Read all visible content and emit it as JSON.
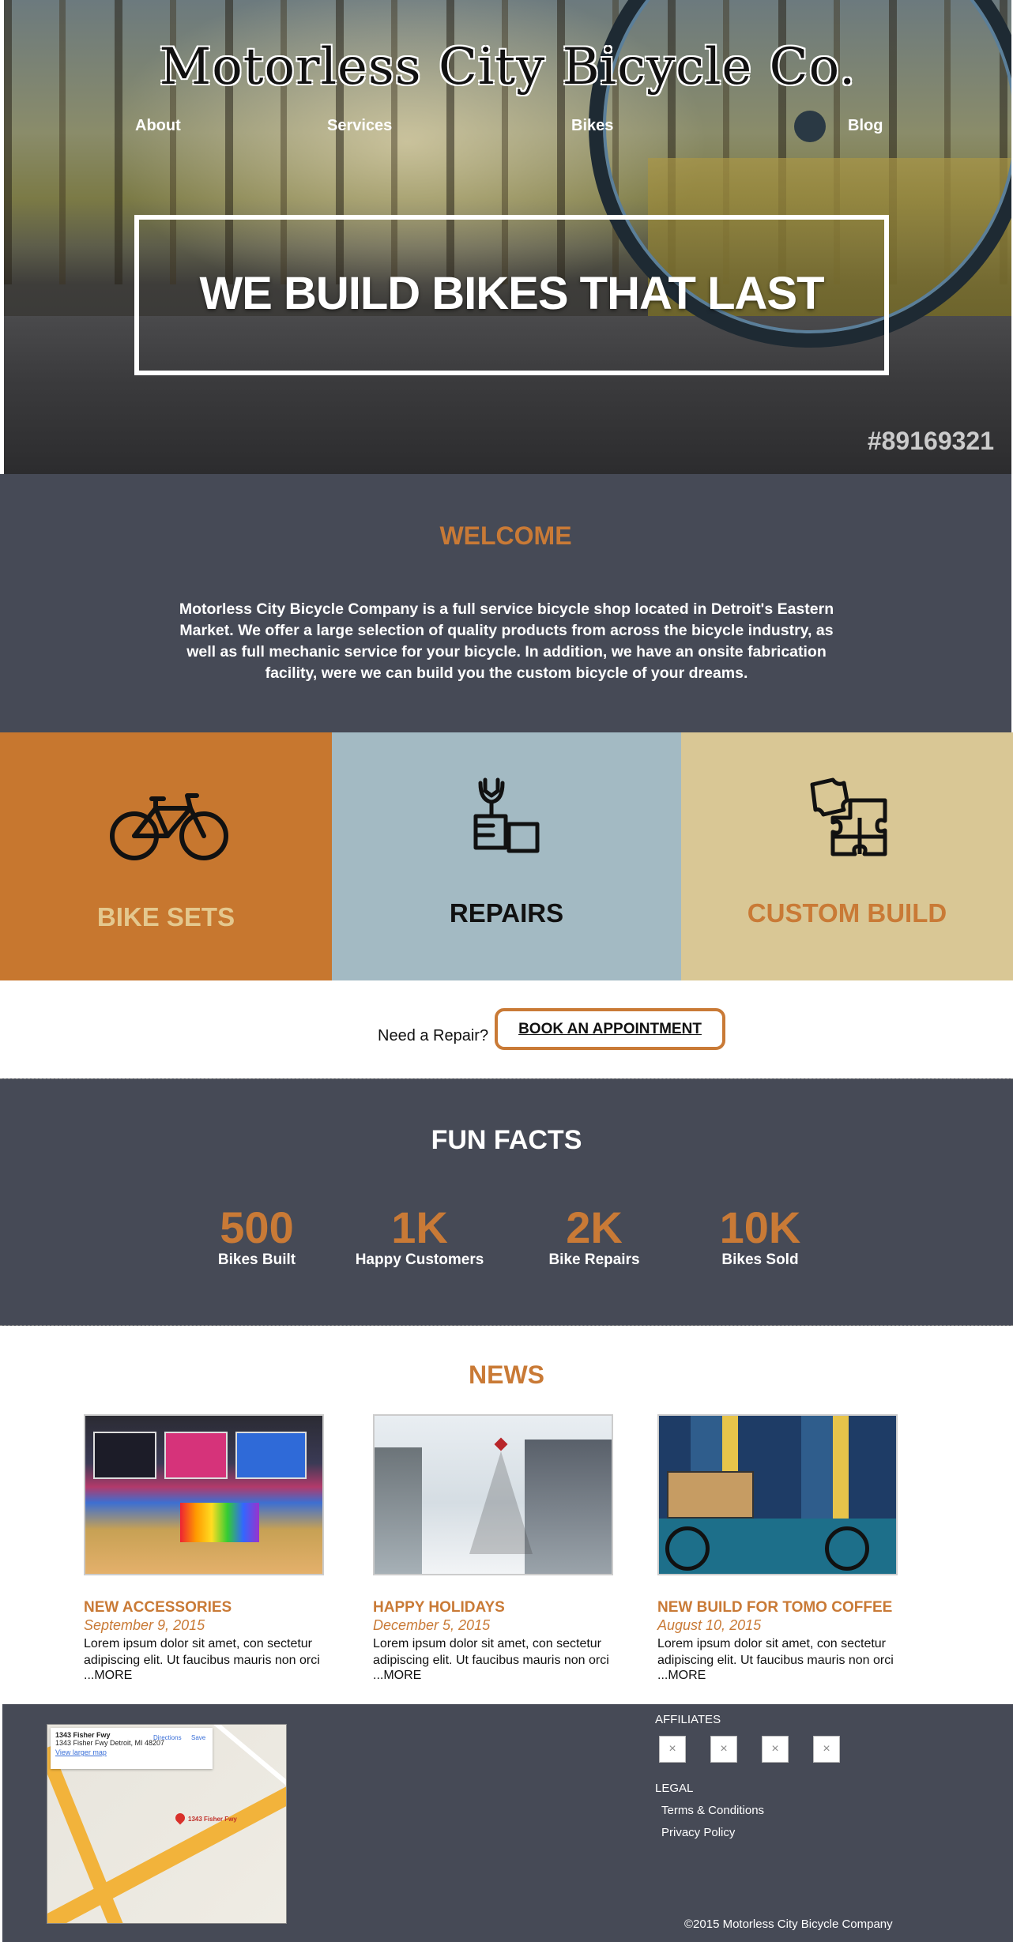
{
  "header": {
    "logo": "Motorless City Bicycle Co.",
    "nav": [
      "About",
      "Services",
      "Bikes",
      "Blog"
    ]
  },
  "hero": {
    "headline": "WE BUILD BIKES THAT LAST",
    "stock_id": "#89169321"
  },
  "welcome": {
    "title": "WELCOME",
    "body": "Motorless City Bicycle Company is a full service bicycle shop located in Detroit's Eastern Market.  We offer a large selection of quality products from across the bicycle industry, as well as full mechanic service for your bicycle.  In addition, we have an onsite fabrication facility, were we can build you the custom bicycle of your dreams."
  },
  "services": [
    {
      "label": "BIKE SETS",
      "icon": "bicycle-icon",
      "bg": "#c7772f",
      "fg": "#e4c88e"
    },
    {
      "label": "REPAIRS",
      "icon": "wrench-hand-icon",
      "bg": "#a3bac3",
      "fg": "#111111"
    },
    {
      "label": "CUSTOM BUILD",
      "icon": "puzzle-icon",
      "bg": "#d9c795",
      "fg": "#c97a36"
    }
  ],
  "cta": {
    "prompt": "Need a Repair?",
    "button": "BOOK AN APPOINTMENT"
  },
  "facts": {
    "title": "FUN FACTS",
    "items": [
      {
        "num": "500",
        "caption": "Bikes Built"
      },
      {
        "num": "1K",
        "caption": "Happy Customers"
      },
      {
        "num": "2K",
        "caption": "Bike Repairs"
      },
      {
        "num": "10K",
        "caption": "Bikes Sold"
      }
    ]
  },
  "news": {
    "title": "NEWS",
    "items": [
      {
        "title": "NEW ACCESSORIES",
        "date": "September 9, 2015",
        "body": "Lorem ipsum dolor sit amet, con sectetur adipiscing elit. Ut faucibus mauris non orci",
        "more": "...MORE"
      },
      {
        "title": "HAPPY HOLIDAYS",
        "date": "December 5, 2015",
        "body": "Lorem ipsum dolor sit amet, con sectetur adipiscing elit. Ut faucibus mauris non orci",
        "more": "...MORE"
      },
      {
        "title": "NEW BUILD FOR TOMO COFFEE",
        "date": "August 10, 2015",
        "body": "Lorem ipsum dolor sit amet, con sectetur adipiscing elit. Ut faucibus mauris non orci",
        "more": "...MORE"
      }
    ]
  },
  "footer": {
    "map": {
      "place": "1343 Fisher Fwy",
      "address": "1343 Fisher Fwy Detroit, MI 48207",
      "larger_map": "View larger map",
      "directions": "Directions",
      "save": "Save",
      "pin_label": "1343 Fisher Fwy"
    },
    "affiliates_title": "AFFILIATES",
    "affiliates_placeholder": "×",
    "legal_title": "LEGAL",
    "legal_links": [
      "Terms & Conditions",
      "Privacy Policy"
    ],
    "copyright": "©2015 Motorless City Bicycle Company"
  },
  "colors": {
    "accent": "#c97a36",
    "dark": "#464a56"
  }
}
